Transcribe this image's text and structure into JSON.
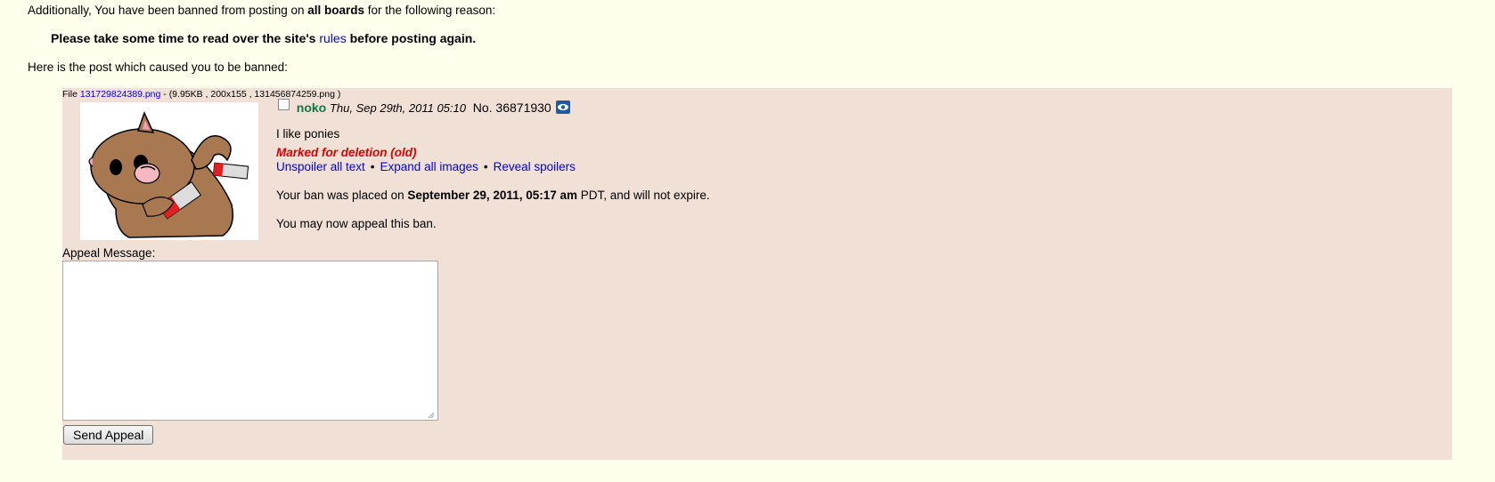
{
  "ban": {
    "line1_pre": "Additionally, You have been banned from posting on ",
    "line1_bold": "all boards",
    "line1_post": " for the following reason:",
    "reason_pre": "Please take some time to read over the site's ",
    "reason_link": "rules",
    "reason_post": " before posting again.",
    "post_intro": "Here is the post which caused you to be banned:"
  },
  "post": {
    "file_label": "File ",
    "file_name": "131729824389.png",
    "file_meta": " - (9.95KB , 200x155 , 131456874259.png )",
    "name": "noko",
    "date": "Thu, Sep 29th, 2011 05:10",
    "number": "No. 36871930",
    "comment": "I like ponies",
    "deletion_notice": "Marked for deletion (old)",
    "links": [
      "Unspoiler all text",
      "Expand all images",
      "Reveal spoilers"
    ],
    "separator": "•",
    "ban_placed_pre": "Your ban was placed on ",
    "ban_placed_date": "September 29, 2011, 05:17 am",
    "ban_placed_tz": " PDT",
    "ban_placed_post": ", and will not expire.",
    "appeal_notice": "You may now appeal this ban."
  },
  "appeal": {
    "label": "Appeal Message:",
    "message": "",
    "button": "Send Appeal"
  },
  "colors": {
    "page_bg": "#ffffee",
    "post_bg": "#f0e0d6",
    "name": "#117743",
    "deletion": "#dd0000",
    "link": "#0000ee"
  },
  "icons": {
    "thumbnail": "cartoon-bear-with-eraser",
    "hide": "eye-icon"
  }
}
